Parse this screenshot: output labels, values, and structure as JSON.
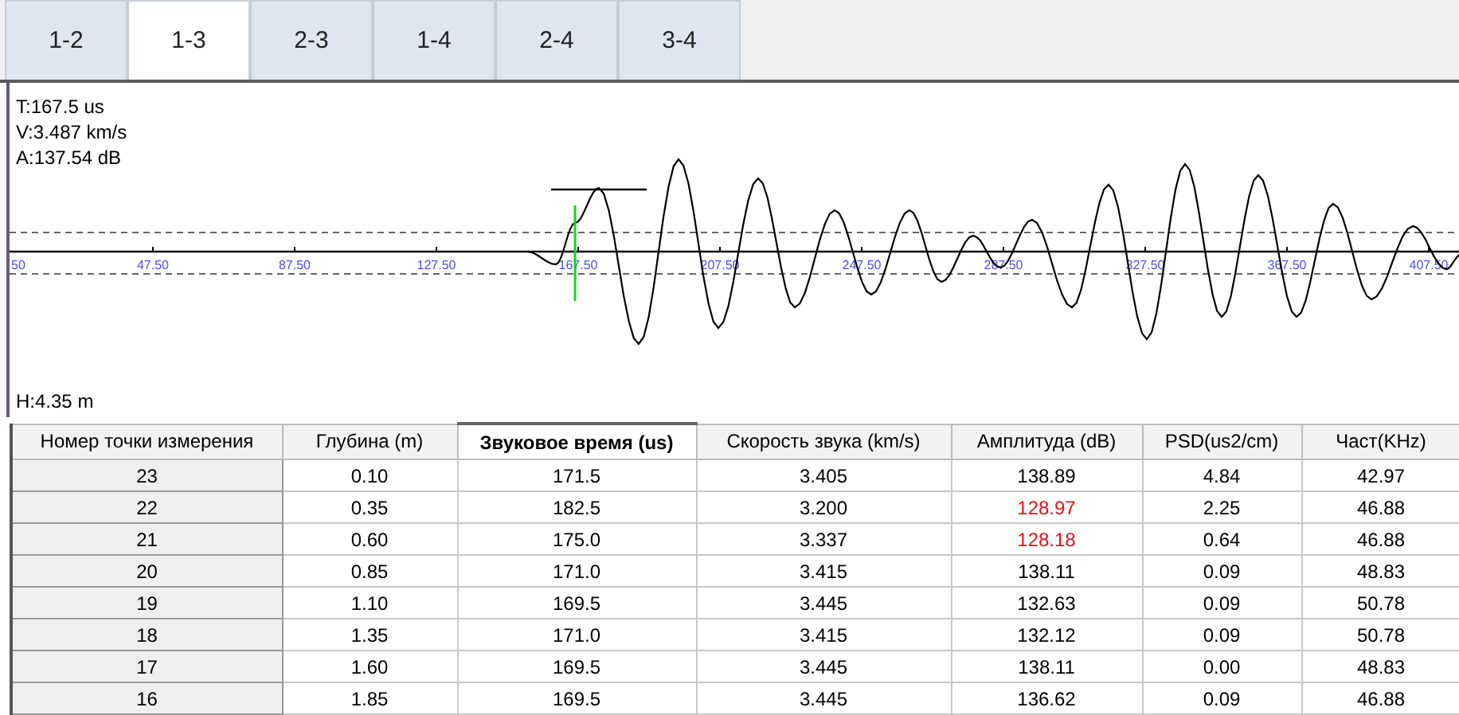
{
  "tabs": [
    {
      "label": "1-2",
      "selected": false
    },
    {
      "label": "1-3",
      "selected": true
    },
    {
      "label": "2-3",
      "selected": false
    },
    {
      "label": "1-4",
      "selected": false
    },
    {
      "label": "2-4",
      "selected": false
    },
    {
      "label": "3-4",
      "selected": false
    }
  ],
  "waveform": {
    "readouts": [
      "T:167.5 us",
      "V:3.487 km/s",
      "A:137.54 dB"
    ],
    "depth_label": "H:4.35 m",
    "x_axis_labels": [
      "50",
      "47.50",
      "87.50",
      "127.50",
      "167.50",
      "207.50",
      "247.50",
      "287.50",
      "327.50",
      "367.50",
      "407.50"
    ]
  },
  "table": {
    "columns": [
      {
        "label": "Номер точки измерения",
        "selected": false
      },
      {
        "label": "Глубина (m)",
        "selected": false
      },
      {
        "label": "Звуковое время (us)",
        "selected": true
      },
      {
        "label": "Скорость звука (km/s)",
        "selected": false
      },
      {
        "label": "Амплитуда (dB)",
        "selected": false
      },
      {
        "label": "PSD(us2/cm)",
        "selected": false
      },
      {
        "label": "Част(KHz)",
        "selected": false
      }
    ],
    "rows": [
      {
        "cells": [
          "23",
          "0.10",
          "171.5",
          "3.405",
          "138.89",
          "4.84",
          "42.97"
        ],
        "amplitude_alert": false
      },
      {
        "cells": [
          "22",
          "0.35",
          "182.5",
          "3.200",
          "128.97",
          "2.25",
          "46.88"
        ],
        "amplitude_alert": true
      },
      {
        "cells": [
          "21",
          "0.60",
          "175.0",
          "3.337",
          "128.18",
          "0.64",
          "46.88"
        ],
        "amplitude_alert": true
      },
      {
        "cells": [
          "20",
          "0.85",
          "171.0",
          "3.415",
          "138.11",
          "0.09",
          "48.83"
        ],
        "amplitude_alert": false
      },
      {
        "cells": [
          "19",
          "1.10",
          "169.5",
          "3.445",
          "132.63",
          "0.09",
          "50.78"
        ],
        "amplitude_alert": false
      },
      {
        "cells": [
          "18",
          "1.35",
          "171.0",
          "3.415",
          "132.12",
          "0.09",
          "50.78"
        ],
        "amplitude_alert": false
      },
      {
        "cells": [
          "17",
          "1.60",
          "169.5",
          "3.445",
          "138.11",
          "0.00",
          "48.83"
        ],
        "amplitude_alert": false
      },
      {
        "cells": [
          "16",
          "1.85",
          "169.5",
          "3.445",
          "136.62",
          "0.09",
          "46.88"
        ],
        "amplitude_alert": false
      }
    ]
  }
}
